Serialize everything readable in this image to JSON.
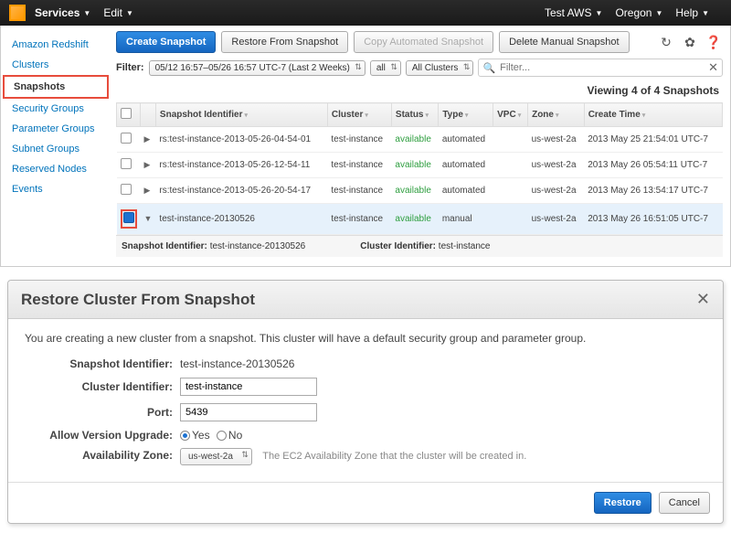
{
  "topbar": {
    "services": "Services",
    "edit": "Edit",
    "account": "Test AWS",
    "region": "Oregon",
    "help": "Help"
  },
  "sidebar": {
    "items": [
      {
        "label": "Amazon Redshift"
      },
      {
        "label": "Clusters"
      },
      {
        "label": "Snapshots"
      },
      {
        "label": "Security Groups"
      },
      {
        "label": "Parameter Groups"
      },
      {
        "label": "Subnet Groups"
      },
      {
        "label": "Reserved Nodes"
      },
      {
        "label": "Events"
      }
    ]
  },
  "toolbar": {
    "create": "Create Snapshot",
    "restore": "Restore From Snapshot",
    "copy": "Copy Automated Snapshot",
    "delete": "Delete Manual Snapshot"
  },
  "filter": {
    "label": "Filter:",
    "range": "05/12 16:57–05/26 16:57 UTC-7 (Last 2 Weeks)",
    "type": "all",
    "cluster": "All Clusters",
    "placeholder": "Filter..."
  },
  "viewing": "Viewing 4 of 4 Snapshots",
  "columns": {
    "id": "Snapshot Identifier",
    "cluster": "Cluster",
    "status": "Status",
    "type": "Type",
    "vpc": "VPC",
    "zone": "Zone",
    "ctime": "Create Time"
  },
  "rows": [
    {
      "id": "rs:test-instance-2013-05-26-04-54-01",
      "cluster": "test-instance",
      "status": "available",
      "type": "automated",
      "vpc": "",
      "zone": "us-west-2a",
      "ctime": "2013 May 25 21:54:01 UTC-7",
      "checked": false,
      "expanded": false
    },
    {
      "id": "rs:test-instance-2013-05-26-12-54-11",
      "cluster": "test-instance",
      "status": "available",
      "type": "automated",
      "vpc": "",
      "zone": "us-west-2a",
      "ctime": "2013 May 26 05:54:11 UTC-7",
      "checked": false,
      "expanded": false
    },
    {
      "id": "rs:test-instance-2013-05-26-20-54-17",
      "cluster": "test-instance",
      "status": "available",
      "type": "automated",
      "vpc": "",
      "zone": "us-west-2a",
      "ctime": "2013 May 26 13:54:17 UTC-7",
      "checked": false,
      "expanded": false
    },
    {
      "id": "test-instance-20130526",
      "cluster": "test-instance",
      "status": "available",
      "type": "manual",
      "vpc": "",
      "zone": "us-west-2a",
      "ctime": "2013 May 26 16:51:05 UTC-7",
      "checked": true,
      "expanded": true
    }
  ],
  "detail": {
    "sidlabel": "Snapshot Identifier:",
    "sid": "test-instance-20130526",
    "cidlabel": "Cluster Identifier:",
    "cid": "test-instance"
  },
  "modal": {
    "title": "Restore Cluster From Snapshot",
    "desc": "You are creating a new cluster from a snapshot. This cluster will have a default security group and parameter group.",
    "sid_label": "Snapshot Identifier:",
    "sid": "test-instance-20130526",
    "cid_label": "Cluster Identifier:",
    "cid": "test-instance",
    "port_label": "Port:",
    "port": "5439",
    "upgrade_label": "Allow Version Upgrade:",
    "yes": "Yes",
    "no": "No",
    "az_label": "Availability Zone:",
    "az": "us-west-2a",
    "az_hint": "The EC2 Availability Zone that the cluster will be created in.",
    "restore": "Restore",
    "cancel": "Cancel"
  }
}
